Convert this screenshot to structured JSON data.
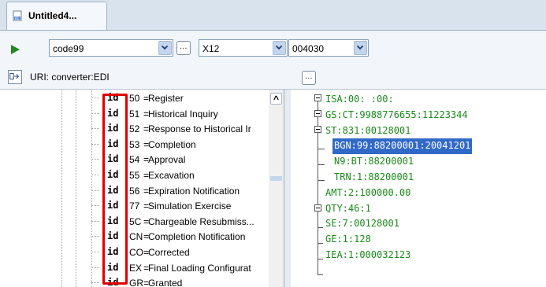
{
  "tab": {
    "label": "Untitled4..."
  },
  "toolbar": {
    "combo1_value": "code99",
    "combo2_value": "X12",
    "combo3_value": "004030",
    "uri_label": "URI: converter:EDI"
  },
  "tree": {
    "rows": [
      {
        "id": "id",
        "code": "50",
        "desc": "Register"
      },
      {
        "id": "id",
        "code": "51",
        "desc": "Historical Inquiry"
      },
      {
        "id": "id",
        "code": "52",
        "desc": "Response to Historical Ir"
      },
      {
        "id": "id",
        "code": "53",
        "desc": "Completion"
      },
      {
        "id": "id",
        "code": "54",
        "desc": "Approval"
      },
      {
        "id": "id",
        "code": "55",
        "desc": "Excavation"
      },
      {
        "id": "id",
        "code": "56",
        "desc": "Expiration Notification"
      },
      {
        "id": "id",
        "code": "77",
        "desc": "Simulation Exercise"
      },
      {
        "id": "id",
        "code": "5C",
        "desc": "Chargeable Resubmiss..."
      },
      {
        "id": "id",
        "code": "CN",
        "desc": "Completion Notification"
      },
      {
        "id": "id",
        "code": "CO",
        "desc": "Corrected"
      },
      {
        "id": "id",
        "code": "EX",
        "desc": "Final Loading Configurat"
      },
      {
        "id": "id",
        "code": "GR",
        "desc": "Granted"
      }
    ]
  },
  "edi": {
    "lines": [
      "ISA:00:          :00:",
      "GS:CT:9988776655:11223344",
      "ST:831:00128001",
      "BGN:99:88200001:20041201",
      "N9:BT:88200001",
      "TRN:1:88200001",
      "AMT:2:100000.00",
      "QTY:46:1",
      "SE:7:00128001",
      "GE:1:128",
      "IEA:1:000032123"
    ]
  },
  "colors": {
    "edi_text": "#1a8a1a",
    "selection": "#3169c6",
    "highlight_box": "#e00000"
  }
}
